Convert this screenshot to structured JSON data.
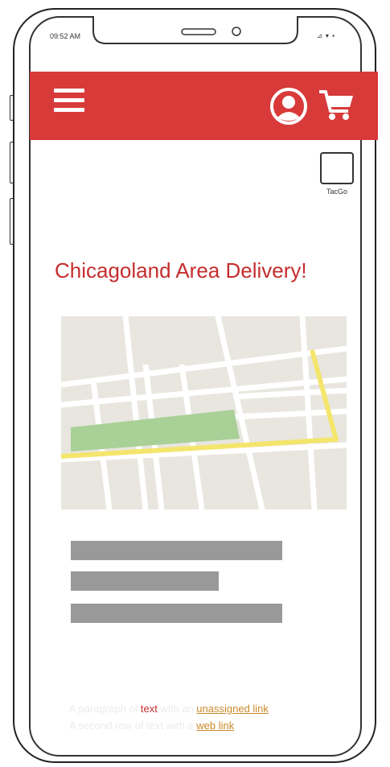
{
  "status_bar": {
    "time": "09:52 AM",
    "icons": "⊿ ▾ ▪"
  },
  "header": {
    "bg_color": "#d83a3a",
    "icons": [
      "menu-icon",
      "account-icon",
      "cart-icon"
    ]
  },
  "logo": {
    "label": "TacGo"
  },
  "main": {
    "headline": "Chicagoland Area Delivery!",
    "headline_color": "#c62d2d"
  },
  "footer": {
    "line1_pre": "A paragraph of ",
    "line1_red": "text",
    "line1_mid": " with an ",
    "line1_link": "unassigned link",
    "line2_pre": "A second row of text with a ",
    "line2_link": "web link"
  }
}
